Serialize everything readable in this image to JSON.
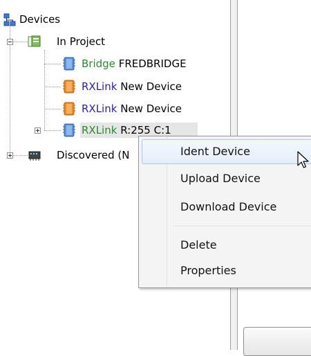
{
  "tree": {
    "root": {
      "label": "Devices",
      "icon": "devices-network-icon"
    },
    "in_project": {
      "label": "In Project",
      "icon": "project-folder-icon"
    },
    "devices": [
      {
        "type": "Bridge",
        "name": "FREDBRIDGE",
        "icon": "blue-device-icon",
        "type_color": "#2b8a2b"
      },
      {
        "type": "RXLink",
        "name": "New Device",
        "icon": "orange-device-icon",
        "type_color": "#2a1fa6"
      },
      {
        "type": "RXLink",
        "name": "New Device",
        "icon": "orange-device-icon",
        "type_color": "#2a1fa6"
      },
      {
        "type": "RXLink",
        "name": "R:255 C:1",
        "icon": "blue-device-icon",
        "type_color": "#2b8a2b"
      }
    ],
    "discovered": {
      "label": "Discovered (N",
      "icon": "discovered-network-icon"
    }
  },
  "context_menu": {
    "items": [
      "Ident Device",
      "Upload Device",
      "Download Device"
    ],
    "items2": [
      "Delete",
      "Properties"
    ],
    "hovered": "Ident Device"
  },
  "colors": {
    "menu_hover_border": "#a8c8ee",
    "selection_bg": "#e6e6e6"
  }
}
